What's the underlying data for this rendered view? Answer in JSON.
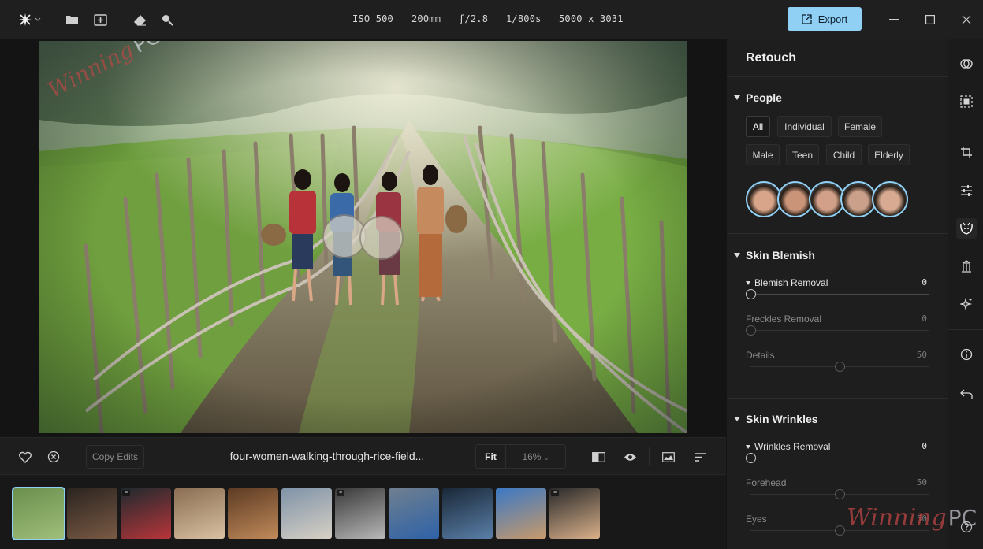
{
  "toolbar": {
    "app_icon": "sparkle-icon",
    "icons": [
      "folder-icon",
      "add-image-icon",
      "eraser-icon",
      "search-icon"
    ],
    "meta": {
      "iso": "ISO 500",
      "focal": "200mm",
      "aperture": "ƒ/2.8",
      "shutter": "1/800s",
      "resolution": "5000 x 3031"
    },
    "export_label": "Export",
    "accent": "#8fd0f4"
  },
  "photo": {
    "watermark_script": "Winning",
    "watermark_pc": "PC"
  },
  "bottombar": {
    "copy_edits_label": "Copy Edits",
    "filename": "four-women-walking-through-rice-field...",
    "zoom_fit": "Fit",
    "zoom_pct": "16%"
  },
  "filmstrip": {
    "thumbs": [
      {
        "colors": [
          "#6b8f4e",
          "#9fbf7a"
        ],
        "badge": false
      },
      {
        "colors": [
          "#2b2420",
          "#7a5a44"
        ],
        "badge": false
      },
      {
        "colors": [
          "#1e2a2e",
          "#b8353a"
        ],
        "badge": true
      },
      {
        "colors": [
          "#8a6d52",
          "#d9c1a3"
        ],
        "badge": false
      },
      {
        "colors": [
          "#5d3b23",
          "#c08a5a"
        ],
        "badge": false
      },
      {
        "colors": [
          "#7f93a8",
          "#d7d0c5"
        ],
        "badge": false
      },
      {
        "colors": [
          "#3a3a3a",
          "#b8b8b8"
        ],
        "badge": true
      },
      {
        "colors": [
          "#6f7f8f",
          "#2e62a8"
        ],
        "badge": false
      },
      {
        "colors": [
          "#1a2838",
          "#5a7fa8"
        ],
        "badge": false
      },
      {
        "colors": [
          "#3b78c4",
          "#c89a6a"
        ],
        "badge": false
      },
      {
        "colors": [
          "#2a2a2a",
          "#d9b08a"
        ],
        "badge": true
      }
    ]
  },
  "panel": {
    "title": "Retouch",
    "people": {
      "label": "People",
      "chips": [
        "All",
        "Individual",
        "Female",
        "Male",
        "Teen",
        "Child",
        "Elderly"
      ],
      "faces": 5
    },
    "blemish": {
      "label": "Skin Blemish",
      "sliders": [
        {
          "label": "Blemish Removal",
          "value": "0",
          "level": 0,
          "active": true
        },
        {
          "label": "Freckles Removal",
          "value": "0",
          "level": 0,
          "active": false
        },
        {
          "label": "Details",
          "value": "50",
          "level": 0.5,
          "active": false
        }
      ]
    },
    "wrinkles": {
      "label": "Skin Wrinkles",
      "sliders": [
        {
          "label": "Wrinkles Removal",
          "value": "0",
          "level": 0,
          "active": true
        },
        {
          "label": "Forehead",
          "value": "50",
          "level": 0.5,
          "active": false
        },
        {
          "label": "Eyes",
          "value": "50",
          "level": 0.5,
          "active": false
        }
      ]
    }
  },
  "rail": {
    "icons": [
      "overlap-circles-icon",
      "select-subject-icon",
      "crop-icon",
      "sliders-icon",
      "retouch-face-icon",
      "building-icon",
      "sparkle-effects-icon",
      "info-icon",
      "undo-icon",
      "help-icon"
    ]
  },
  "corner_watermark": {
    "script": "Winning",
    "pc": "PC"
  }
}
